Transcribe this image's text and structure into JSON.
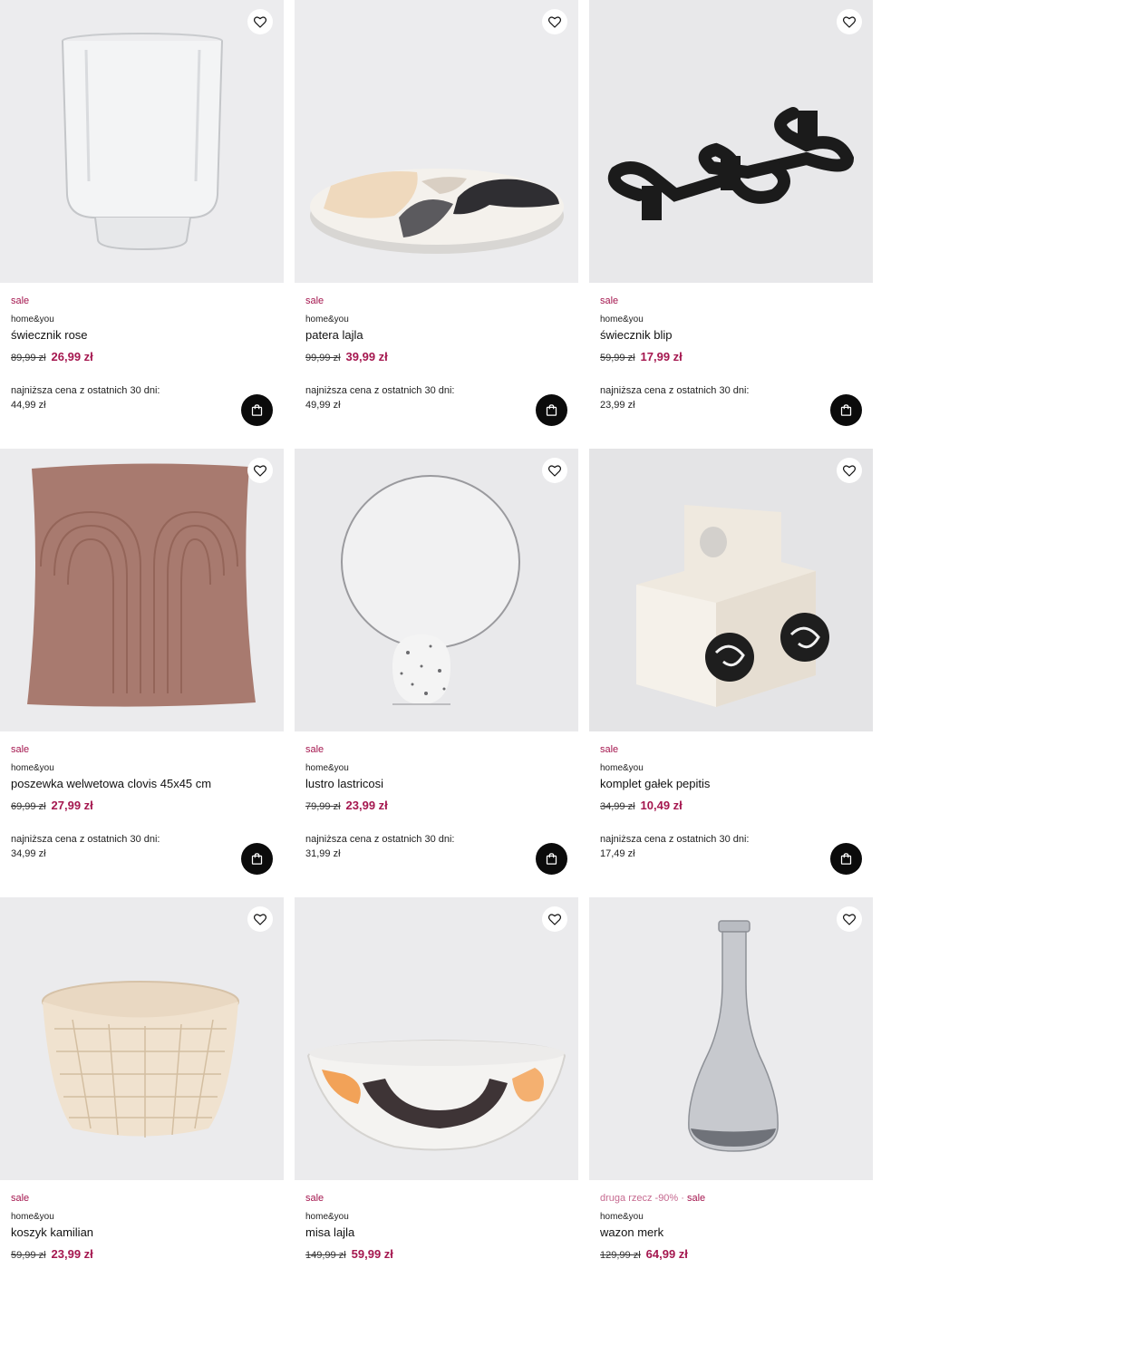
{
  "products": [
    {
      "badge": "sale",
      "brand": "home&you",
      "name": "świecznik rose",
      "old_price": "89,99 zł",
      "new_price": "26,99 zł",
      "lowest_label": "najniższa cena z ostatnich 30 dni:",
      "lowest_price": "44,99 zł"
    },
    {
      "badge": "sale",
      "brand": "home&you",
      "name": "patera lajla",
      "old_price": "99,99 zł",
      "new_price": "39,99 zł",
      "lowest_label": "najniższa cena z ostatnich 30 dni:",
      "lowest_price": "49,99 zł"
    },
    {
      "badge": "sale",
      "brand": "home&you",
      "name": "świecznik blip",
      "old_price": "59,99 zł",
      "new_price": "17,99 zł",
      "lowest_label": "najniższa cena z ostatnich 30 dni:",
      "lowest_price": "23,99 zł"
    },
    {
      "badge": "sale",
      "brand": "home&you",
      "name": "poszewka welwetowa clovis 45x45 cm",
      "old_price": "69,99 zł",
      "new_price": "27,99 zł",
      "lowest_label": "najniższa cena z ostatnich 30 dni:",
      "lowest_price": "34,99 zł"
    },
    {
      "badge": "sale",
      "brand": "home&you",
      "name": "lustro lastricosi",
      "old_price": "79,99 zł",
      "new_price": "23,99 zł",
      "lowest_label": "najniższa cena z ostatnich 30 dni:",
      "lowest_price": "31,99 zł"
    },
    {
      "badge": "sale",
      "brand": "home&you",
      "name": "komplet gałek pepitis",
      "old_price": "34,99 zł",
      "new_price": "10,49 zł",
      "lowest_label": "najniższa cena z ostatnich 30 dni:",
      "lowest_price": "17,49 zł"
    },
    {
      "badge": "sale",
      "brand": "home&you",
      "name": "koszyk kamilian",
      "old_price": "59,99 zł",
      "new_price": "23,99 zł"
    },
    {
      "badge": "sale",
      "brand": "home&you",
      "name": "misa lajla",
      "old_price": "149,99 zł",
      "new_price": "59,99 zł"
    },
    {
      "promo": "druga rzecz -90%",
      "separator": " · ",
      "badge": "sale",
      "brand": "home&you",
      "name": "wazon merk",
      "old_price": "129,99 zł",
      "new_price": "64,99 zł"
    }
  ],
  "icons": {
    "favorite": "heart-outline-icon",
    "cart": "shopping-bag-icon"
  },
  "colors": {
    "sale": "#a5174f",
    "promo": "#c66a90",
    "cart_button": "#0b0b0b",
    "image_bg": "#ebebed"
  }
}
